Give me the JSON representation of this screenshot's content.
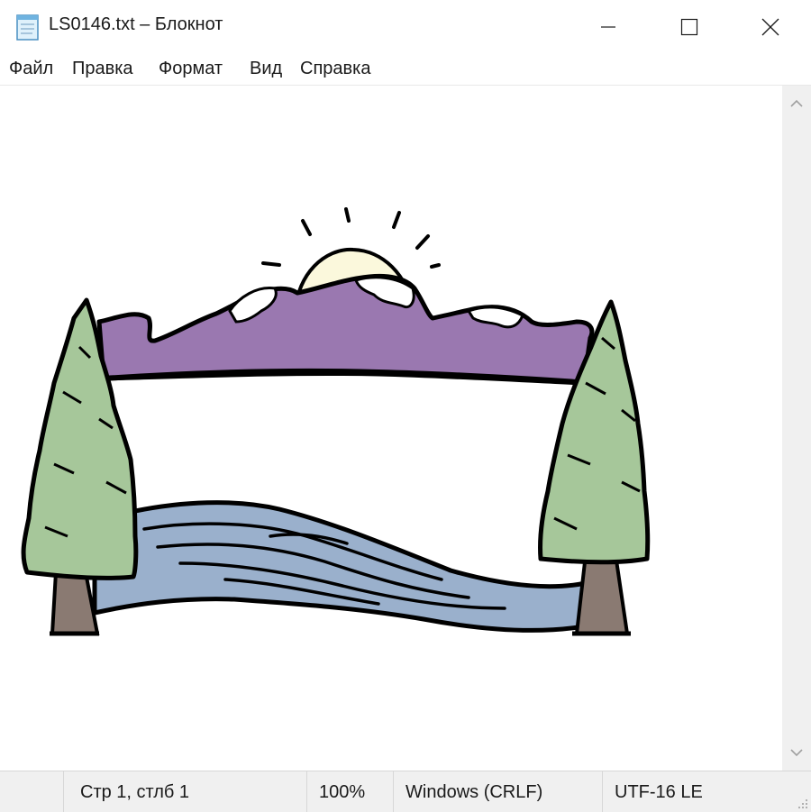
{
  "window": {
    "title": "LS0146.txt – Блокнот",
    "icon": "notepad-icon",
    "controls": [
      "minimize-icon",
      "maximize-icon",
      "close-icon"
    ]
  },
  "menu": {
    "items": [
      "Файл",
      "Правка",
      "Формат",
      "Вид",
      "Справка"
    ]
  },
  "editor": {
    "content_type": "ascii-art",
    "picture": "landscape-frame-illustration"
  },
  "status": {
    "position": "Стр 1, стлб 1",
    "zoom": "100%",
    "line_endings": "Windows (CRLF)",
    "encoding": "UTF-16 LE"
  },
  "colors": {
    "mountains": "#9a78b0",
    "trees": "#a6c79a",
    "river": "#9ab0cc",
    "trunk": "#8a7a72",
    "sun": "#fbf8dc",
    "outline": "#000000"
  }
}
